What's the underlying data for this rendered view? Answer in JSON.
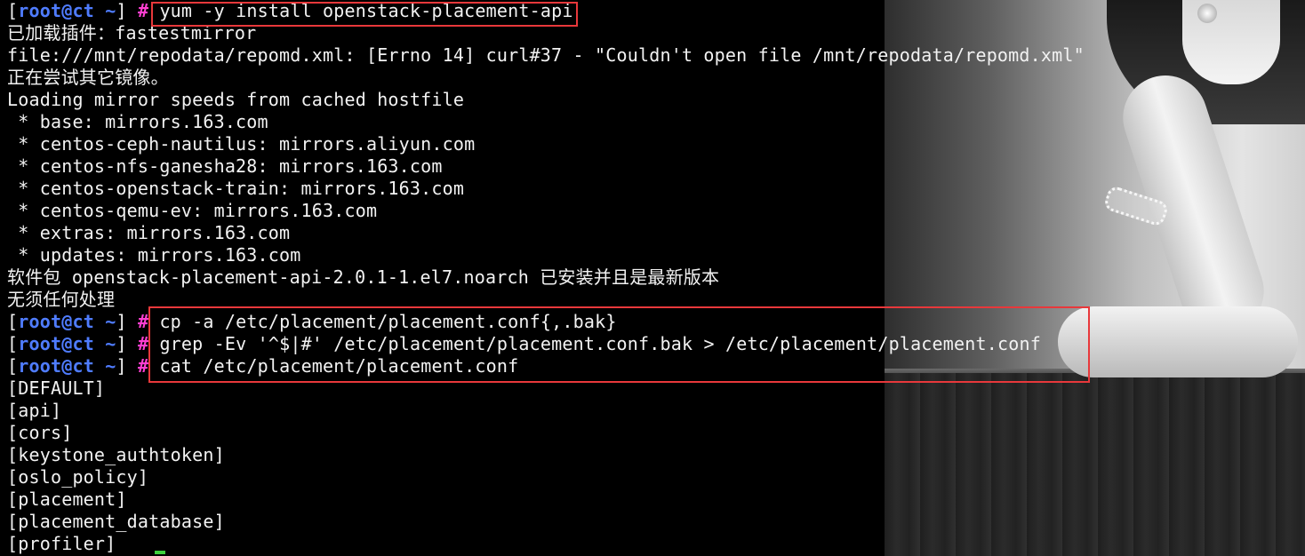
{
  "prompt": {
    "open_bracket": "[",
    "user": "root",
    "at": "@",
    "host": "ct",
    "tilde": " ~",
    "close_bracket": "]",
    "hash": "#"
  },
  "lines": [
    {
      "type": "prompt",
      "cmd": "yum -y install openstack-placement-api"
    },
    {
      "type": "out",
      "text": "已加载插件：fastestmirror"
    },
    {
      "type": "out",
      "text": "file:///mnt/repodata/repomd.xml: [Errno 14] curl#37 - \"Couldn't open file /mnt/repodata/repomd.xml\""
    },
    {
      "type": "out",
      "text": "正在尝试其它镜像。"
    },
    {
      "type": "out",
      "text": "Loading mirror speeds from cached hostfile"
    },
    {
      "type": "out",
      "text": " * base: mirrors.163.com"
    },
    {
      "type": "out",
      "text": " * centos-ceph-nautilus: mirrors.aliyun.com"
    },
    {
      "type": "out",
      "text": " * centos-nfs-ganesha28: mirrors.163.com"
    },
    {
      "type": "out",
      "text": " * centos-openstack-train: mirrors.163.com"
    },
    {
      "type": "out",
      "text": " * centos-qemu-ev: mirrors.163.com"
    },
    {
      "type": "out",
      "text": " * extras: mirrors.163.com"
    },
    {
      "type": "out",
      "text": " * updates: mirrors.163.com"
    },
    {
      "type": "out",
      "text": "软件包 openstack-placement-api-2.0.1-1.el7.noarch 已安装并且是最新版本"
    },
    {
      "type": "out",
      "text": "无须任何处理"
    },
    {
      "type": "prompt",
      "cmd": "cp -a /etc/placement/placement.conf{,.bak}"
    },
    {
      "type": "prompt",
      "cmd": "grep -Ev '^$|#' /etc/placement/placement.conf.bak > /etc/placement/placement.conf"
    },
    {
      "type": "prompt",
      "cmd": "cat /etc/placement/placement.conf"
    },
    {
      "type": "out",
      "text": "[DEFAULT]"
    },
    {
      "type": "out",
      "text": "[api]"
    },
    {
      "type": "out",
      "text": "[cors]"
    },
    {
      "type": "out",
      "text": "[keystone_authtoken]"
    },
    {
      "type": "out",
      "text": "[oslo_policy]"
    },
    {
      "type": "out",
      "text": "[placement]"
    },
    {
      "type": "out",
      "text": "[placement_database]"
    },
    {
      "type": "out",
      "text": "[profiler]"
    }
  ],
  "colors": {
    "background": "#000000",
    "text": "#f2f2f2",
    "prompt_user": "#4f7cff",
    "prompt_hash": "#ff3fd2",
    "highlight_box": "#e8383b",
    "cursor": "#3ccf3c"
  }
}
